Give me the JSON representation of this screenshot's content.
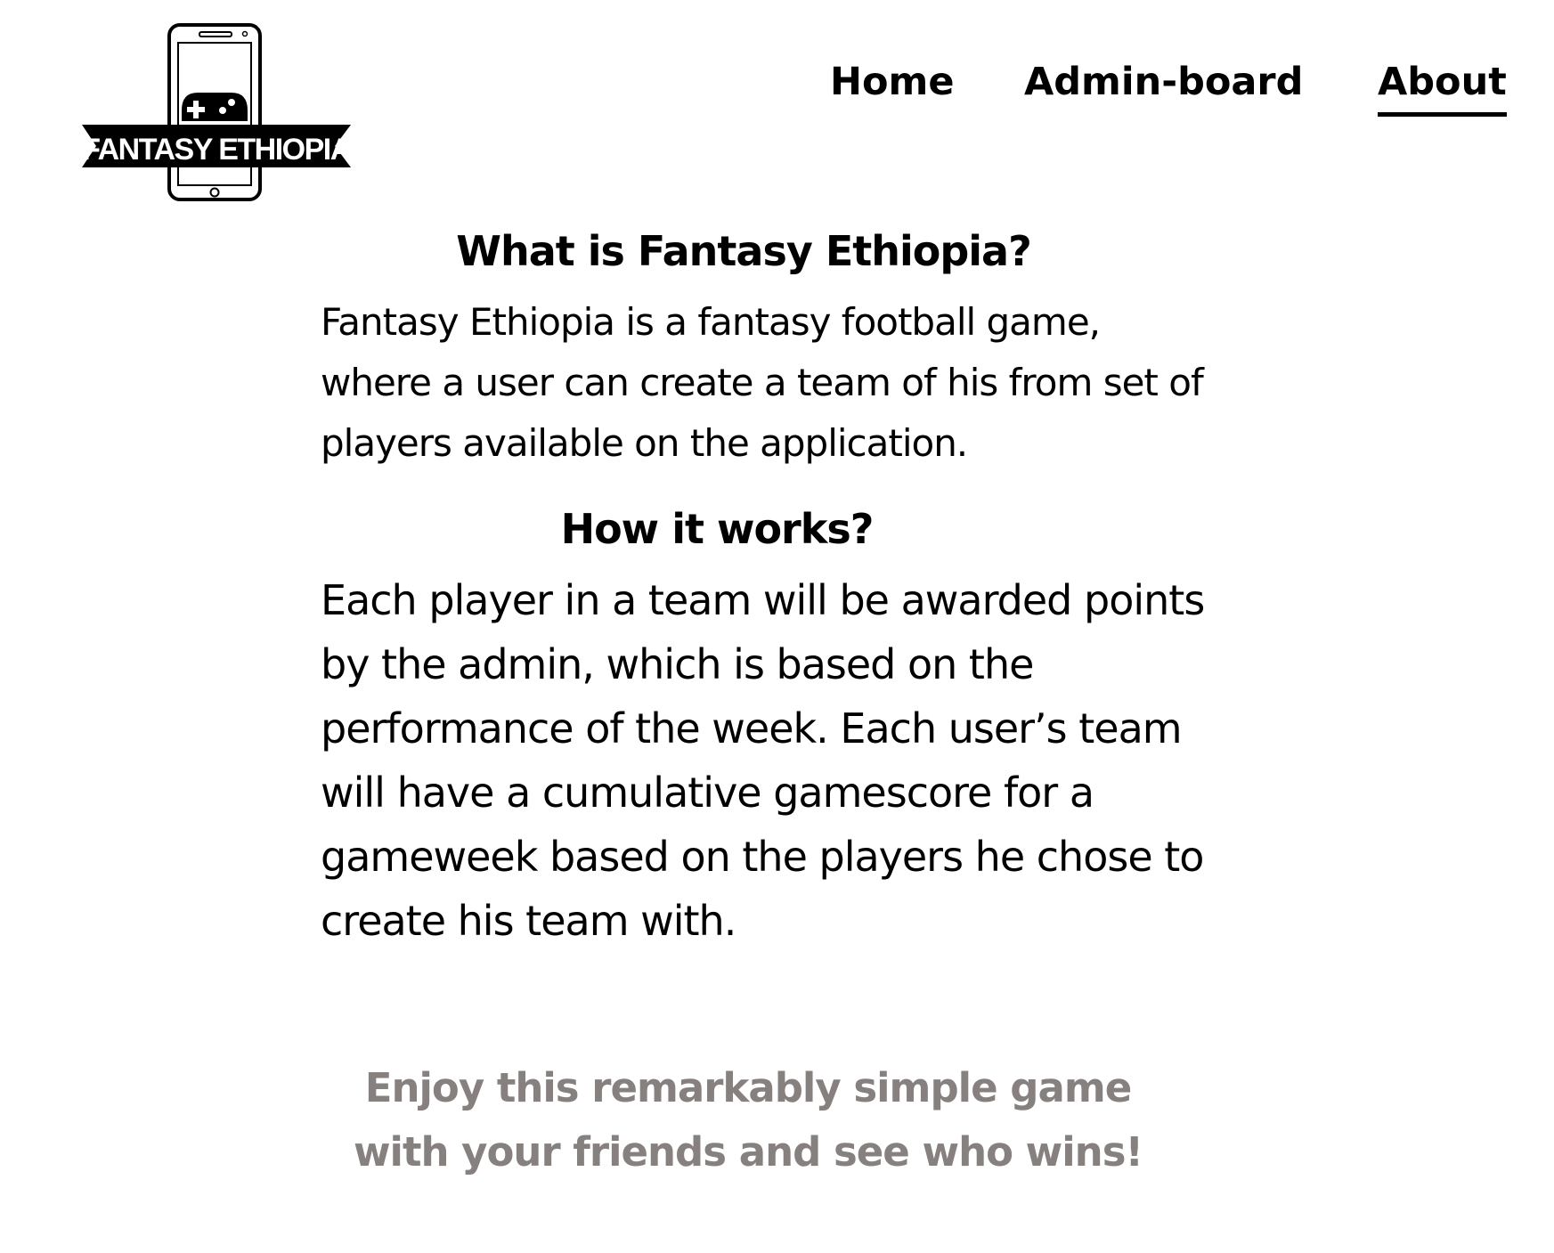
{
  "logo": {
    "text": "FANTASY ETHIOPIA"
  },
  "nav": {
    "home": "Home",
    "admin_board": "Admin-board",
    "about": "About",
    "active": "About"
  },
  "about": {
    "title_1": "What is Fantasy Ethiopia?",
    "paragraph_1": "Fantasy Ethiopia is a fantasy football game, where a user can create a team of his from set of players available on the application.",
    "title_2": "How it works?",
    "paragraph_2": "Each player in a team will be awarded points by the admin, which is based on the performance of the week. Each user’s team will have a cumulative gamescore for a gameweek based on the players he chose to create his team with.",
    "tagline": "Enjoy this remarkably simple game with your friends and see who wins!"
  },
  "colors": {
    "text": "#000000",
    "tagline": "#86807f",
    "background": "#ffffff"
  },
  "icons": {
    "logo": "phone-gamepad-logo"
  }
}
